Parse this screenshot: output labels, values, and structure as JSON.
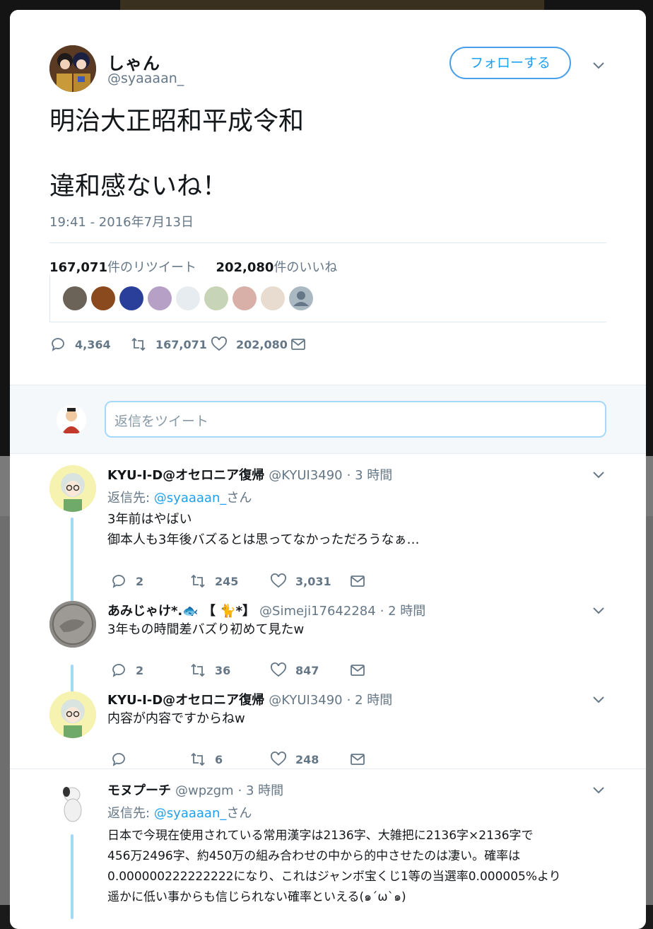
{
  "tweet": {
    "author_name": "しゃん",
    "author_handle": "@syaaaan_",
    "follow_label": "フォローする",
    "text_line1": "明治大正昭和平成令和",
    "text_line2": "違和感ないね！",
    "timestamp": "19:41 - 2016年7月13日",
    "retweet_count": "167,071",
    "retweet_label": "件のリツイート",
    "like_count": "202,080",
    "like_label": "件のいいね",
    "actions": {
      "reply": "4,364",
      "retweet": "167,071",
      "like": "202,080"
    }
  },
  "reply_box": {
    "placeholder": "返信をツイート"
  },
  "replies": [
    {
      "name": "KYU-I-D@オセロニア復帰",
      "handle": "@KYUI3490",
      "time": "· 3 時間",
      "reply_to_prefix": "返信先: ",
      "reply_to_link": "@syaaaan_",
      "reply_to_suffix": "さん",
      "text_lines": [
        "3年前はやばい",
        "御本人も3年後バズるとは思ってなかっただろうなぁ…"
      ],
      "actions": {
        "reply": "2",
        "retweet": "245",
        "like": "3,031"
      }
    },
    {
      "name": "あみじゃけ*.🐟 【 🐈*】",
      "handle": "@Simeji17642284",
      "time": "· 2 時間",
      "text_lines": [
        "3年もの時間差バズり初めて見たw"
      ],
      "actions": {
        "reply": "2",
        "retweet": "36",
        "like": "847"
      }
    },
    {
      "name": "KYU-I-D@オセロニア復帰",
      "handle": "@KYUI3490",
      "time": "· 2 時間",
      "text_lines": [
        "内容が内容ですからねw"
      ],
      "actions": {
        "reply": "",
        "retweet": "6",
        "like": "248"
      }
    },
    {
      "name": "モヌプーチ",
      "handle": "@wpzgm",
      "time": "· 3 時間",
      "reply_to_prefix": "返信先: ",
      "reply_to_link": "@syaaaan_",
      "reply_to_suffix": "さん",
      "text_lines": [
        "日本で今現在使用されている常用漢字は2136字、大雑把に2136字×2136字で",
        "456万2496字、約450万の組み合わせの中から的中させたのは凄い。確率は",
        "0.000000222222222になり、これはジャンボ宝くじ1等の当選率0.000005%より",
        "遥かに低い事からも信じられない確率といえる(๑´ω`๑)"
      ]
    }
  ],
  "colors": {
    "accent": "#1da1f2",
    "text": "#14171a",
    "muted": "#657786",
    "thread": "#a4d9f9"
  }
}
